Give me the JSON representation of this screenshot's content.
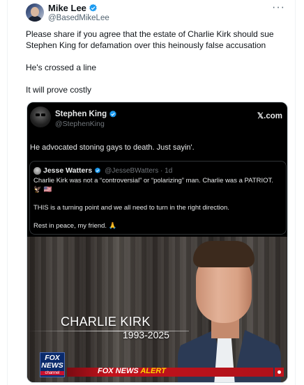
{
  "tweet": {
    "author_name": "Mike Lee",
    "author_handle": "@BasedMikeLee",
    "more_label": "···",
    "paragraphs": [
      "Please share if you agree that the estate of Charlie Kirk should sue Stephen King for defamation over this heinously false accusation",
      "He's crossed a line",
      "It will prove costly"
    ]
  },
  "embedded": {
    "author_name": "Stephen King",
    "author_handle": "@StephenKing",
    "source": "𝕏.com",
    "text": "He advocated stoning gays to death. Just sayin'.",
    "quote": {
      "author_name": "Jesse Watters",
      "author_handle": "@JesseBWatters · 1d",
      "line1": "Charlie Kirk was not a “controversial” or “polarizing” man. Charlie was a PATRIOT. 🦅 🇺🇸",
      "line2": "THIS is a turning point and we all need to turn in the right direction.",
      "line3": "Rest in peace, my friend. 🙏"
    },
    "media": {
      "caption_name": "CHARLIE KIRK",
      "caption_years": "1993-2025",
      "logo_line1": "FOX",
      "logo_line2": "NEWS",
      "logo_line3": "channel",
      "alert_fox": "FOX NEWS",
      "alert_word": "ALERT"
    }
  },
  "colors": {
    "verified_blue": "#1d9bf0",
    "alert_red": "#c2131c",
    "alert_yellow": "#ffd400"
  }
}
